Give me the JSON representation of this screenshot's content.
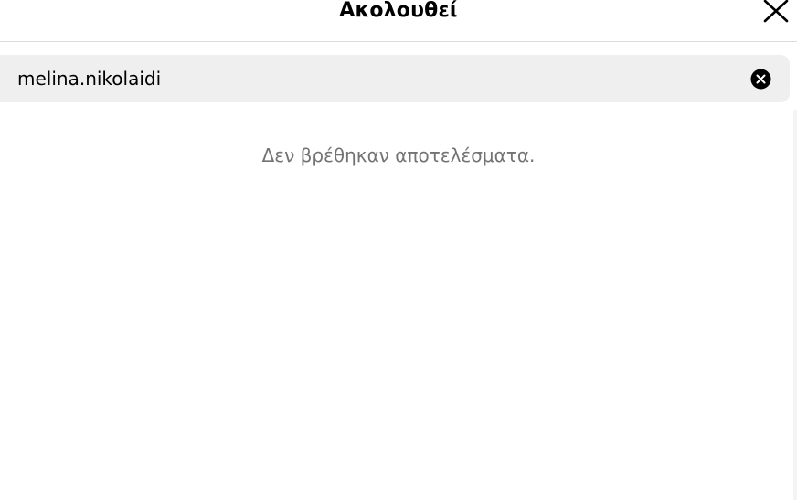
{
  "dialog": {
    "title": "Ακολουθεί",
    "close_icon": "close-icon"
  },
  "search": {
    "value": "melina.nikolaidi",
    "clear_icon": "clear-circle-icon"
  },
  "results": {
    "empty_message": "Δεν βρέθηκαν αποτελέσματα."
  }
}
